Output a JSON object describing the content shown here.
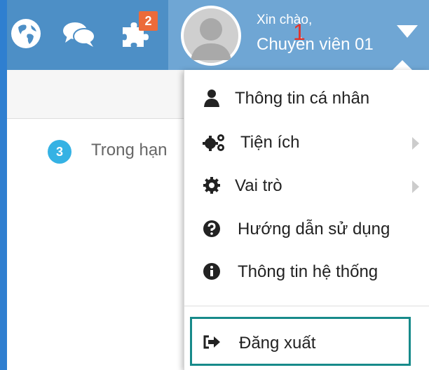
{
  "header": {
    "notification_count": "2",
    "greeting": "Xin chào,",
    "username": "Chuyên viên 01",
    "annotation_marker": "1",
    "icons": [
      "globe-icon",
      "chat-icon",
      "puzzle-icon",
      "avatar",
      "caret-down-icon"
    ]
  },
  "content": {
    "status_count": "3",
    "status_label": "Trong hạn"
  },
  "menu": {
    "items": [
      {
        "label": "Thông tin cá nhân",
        "icon": "user-icon"
      },
      {
        "label": "Tiện ích",
        "icon": "cogs-icon",
        "has_submenu": true
      },
      {
        "label": "Vai trò",
        "icon": "gear-icon",
        "has_submenu": true
      },
      {
        "label": "Hướng dẫn sử dụng",
        "icon": "question-circle-icon"
      },
      {
        "label": "Thông tin hệ thống",
        "icon": "info-circle-icon"
      }
    ],
    "logout": {
      "label": "Đăng xuất",
      "icon": "sign-out-icon"
    }
  },
  "colors": {
    "topbar": "#4d8fc6",
    "topbar_user": "#6fa6d4",
    "badge": "#ec6b3a",
    "count_badge": "#35b2e4",
    "highlight": "#178a8a",
    "marker": "#e2332a"
  }
}
